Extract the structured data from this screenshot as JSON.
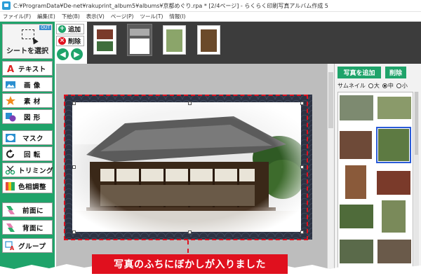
{
  "window": {
    "title": "C:¥ProgramData¥De-net¥rakuprint_album5¥albums¥京都めぐり.rpa * [2/4ページ] - らくらく印刷写真アルバム作成 5"
  },
  "menu": [
    "ファイル(F)",
    "編集(E)",
    "下絵(B)",
    "表示(V)",
    "ページ(P)",
    "ツール(T)",
    "情報(I)"
  ],
  "left_tools": {
    "out_badge": "OUT",
    "select_sheet": "シートを選択",
    "items": [
      {
        "label": "テキスト",
        "icon": "text-icon"
      },
      {
        "label": "画 像",
        "icon": "image-icon"
      },
      {
        "label": "素 材",
        "icon": "star-icon"
      },
      {
        "label": "図 形",
        "icon": "shape-icon"
      },
      {
        "label": "マスク",
        "icon": "mask-icon"
      },
      {
        "label": "回 転",
        "icon": "rotate-icon"
      },
      {
        "label": "トリミング",
        "icon": "scissors-icon"
      },
      {
        "label": "色相調整",
        "icon": "color-adjust-icon"
      },
      {
        "label": "前面に",
        "icon": "bring-front-icon"
      },
      {
        "label": "背面に",
        "icon": "send-back-icon"
      },
      {
        "label": "グループ",
        "icon": "group-icon"
      }
    ]
  },
  "page_controls": {
    "add": "追加",
    "delete": "削除",
    "prev_icon": "arrow-left-icon",
    "next_icon": "arrow-right-icon"
  },
  "right_panel": {
    "add_photo": "写真を追加",
    "delete": "削除",
    "thumbnail_label": "サムネイル",
    "sizes": [
      "大",
      "中",
      "小"
    ],
    "selected_size": "中"
  },
  "caption": "写真のふちにぼかしが入りました",
  "colors": {
    "accent_green": "#1fa36a",
    "highlight_red": "#e0101e",
    "selection_blue": "#2a5bd7"
  }
}
